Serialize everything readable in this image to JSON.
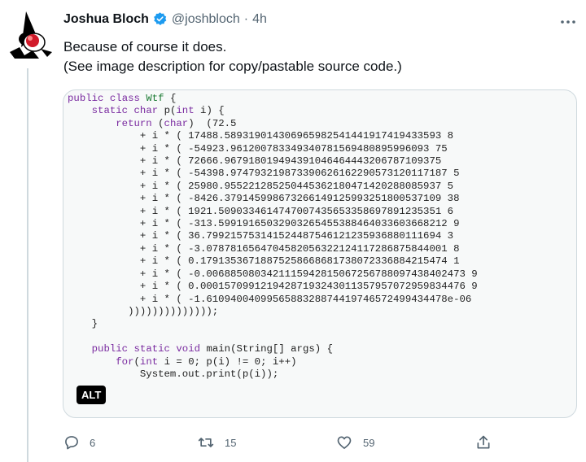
{
  "tweet": {
    "name": "Joshua Bloch",
    "handle": "@joshbloch",
    "dot": "·",
    "time": "4h",
    "text_line1": "Because of course it does.",
    "text_line2": "(See image description for copy/pastable source code.)"
  },
  "media": {
    "alt_badge": "ALT",
    "code": [
      {
        "t": "public",
        "c": "kw"
      },
      {
        "t": " "
      },
      {
        "t": "class",
        "c": "kw"
      },
      {
        "t": " "
      },
      {
        "t": "Wtf",
        "c": "ty"
      },
      {
        "t": " {\n    "
      },
      {
        "t": "static",
        "c": "kw"
      },
      {
        "t": " "
      },
      {
        "t": "char",
        "c": "kw"
      },
      {
        "t": " p("
      },
      {
        "t": "int",
        "c": "kw"
      },
      {
        "t": " i) {\n        "
      },
      {
        "t": "return",
        "c": "kw"
      },
      {
        "t": " ("
      },
      {
        "t": "char",
        "c": "kw"
      },
      {
        "t": ")  (72.5\n            + i * ( 17488.589319014306965982541441917419433593 8\n            + i * ( -54923.961200783349340781569480895996093 75\n            + i * ( 72666.967918019494391046464443206787109375\n            + i * ( -54398.974793219873390626162290573120117187 5\n            + i * ( 25980.955221285250445362180471420288085937 5\n            + i * ( -8426.379145998673266149125993251800537109 38\n            + i * ( 1921.5090334614747007435653358697891235351 6\n            + i * ( -313.59919165032903265455388464033603668212 9\n            + i * ( 36.799215753141524487546121235936880111694 3\n            + i * ( -3.0787816564704582056322124117286875844001 8\n            + i * ( 0.17913536718875258668681738072336884215474 1\n            + i * ( -0.0068850803421115942815067256788097438402473 9\n            + i * ( 0.00015709912194287193243011357957072959834476 9\n            + i * ( -1.6109400409956588328874419746572499434478e-06\n          ))))))))))))));\n    }\n\n    "
      },
      {
        "t": "public",
        "c": "kw"
      },
      {
        "t": " "
      },
      {
        "t": "static",
        "c": "kw"
      },
      {
        "t": " "
      },
      {
        "t": "void",
        "c": "kw"
      },
      {
        "t": " main(String[] args) {\n        "
      },
      {
        "t": "for",
        "c": "kw"
      },
      {
        "t": "("
      },
      {
        "t": "int",
        "c": "kw"
      },
      {
        "t": " i = 0; p(i) != 0; i++)\n            System.out.print(p(i));\n"
      }
    ]
  },
  "actions": {
    "replies": "6",
    "retweets": "15",
    "likes": "59"
  },
  "icons": {
    "more": "more-horizontal-icon",
    "verified": "verified-badge-icon",
    "reply": "reply-icon",
    "retweet": "retweet-icon",
    "like": "heart-icon",
    "share": "share-icon"
  },
  "colors": {
    "verified": "#1d9bf0",
    "keyword": "#7a2ba0",
    "type": "#1b7a33",
    "muted": "#536471"
  }
}
